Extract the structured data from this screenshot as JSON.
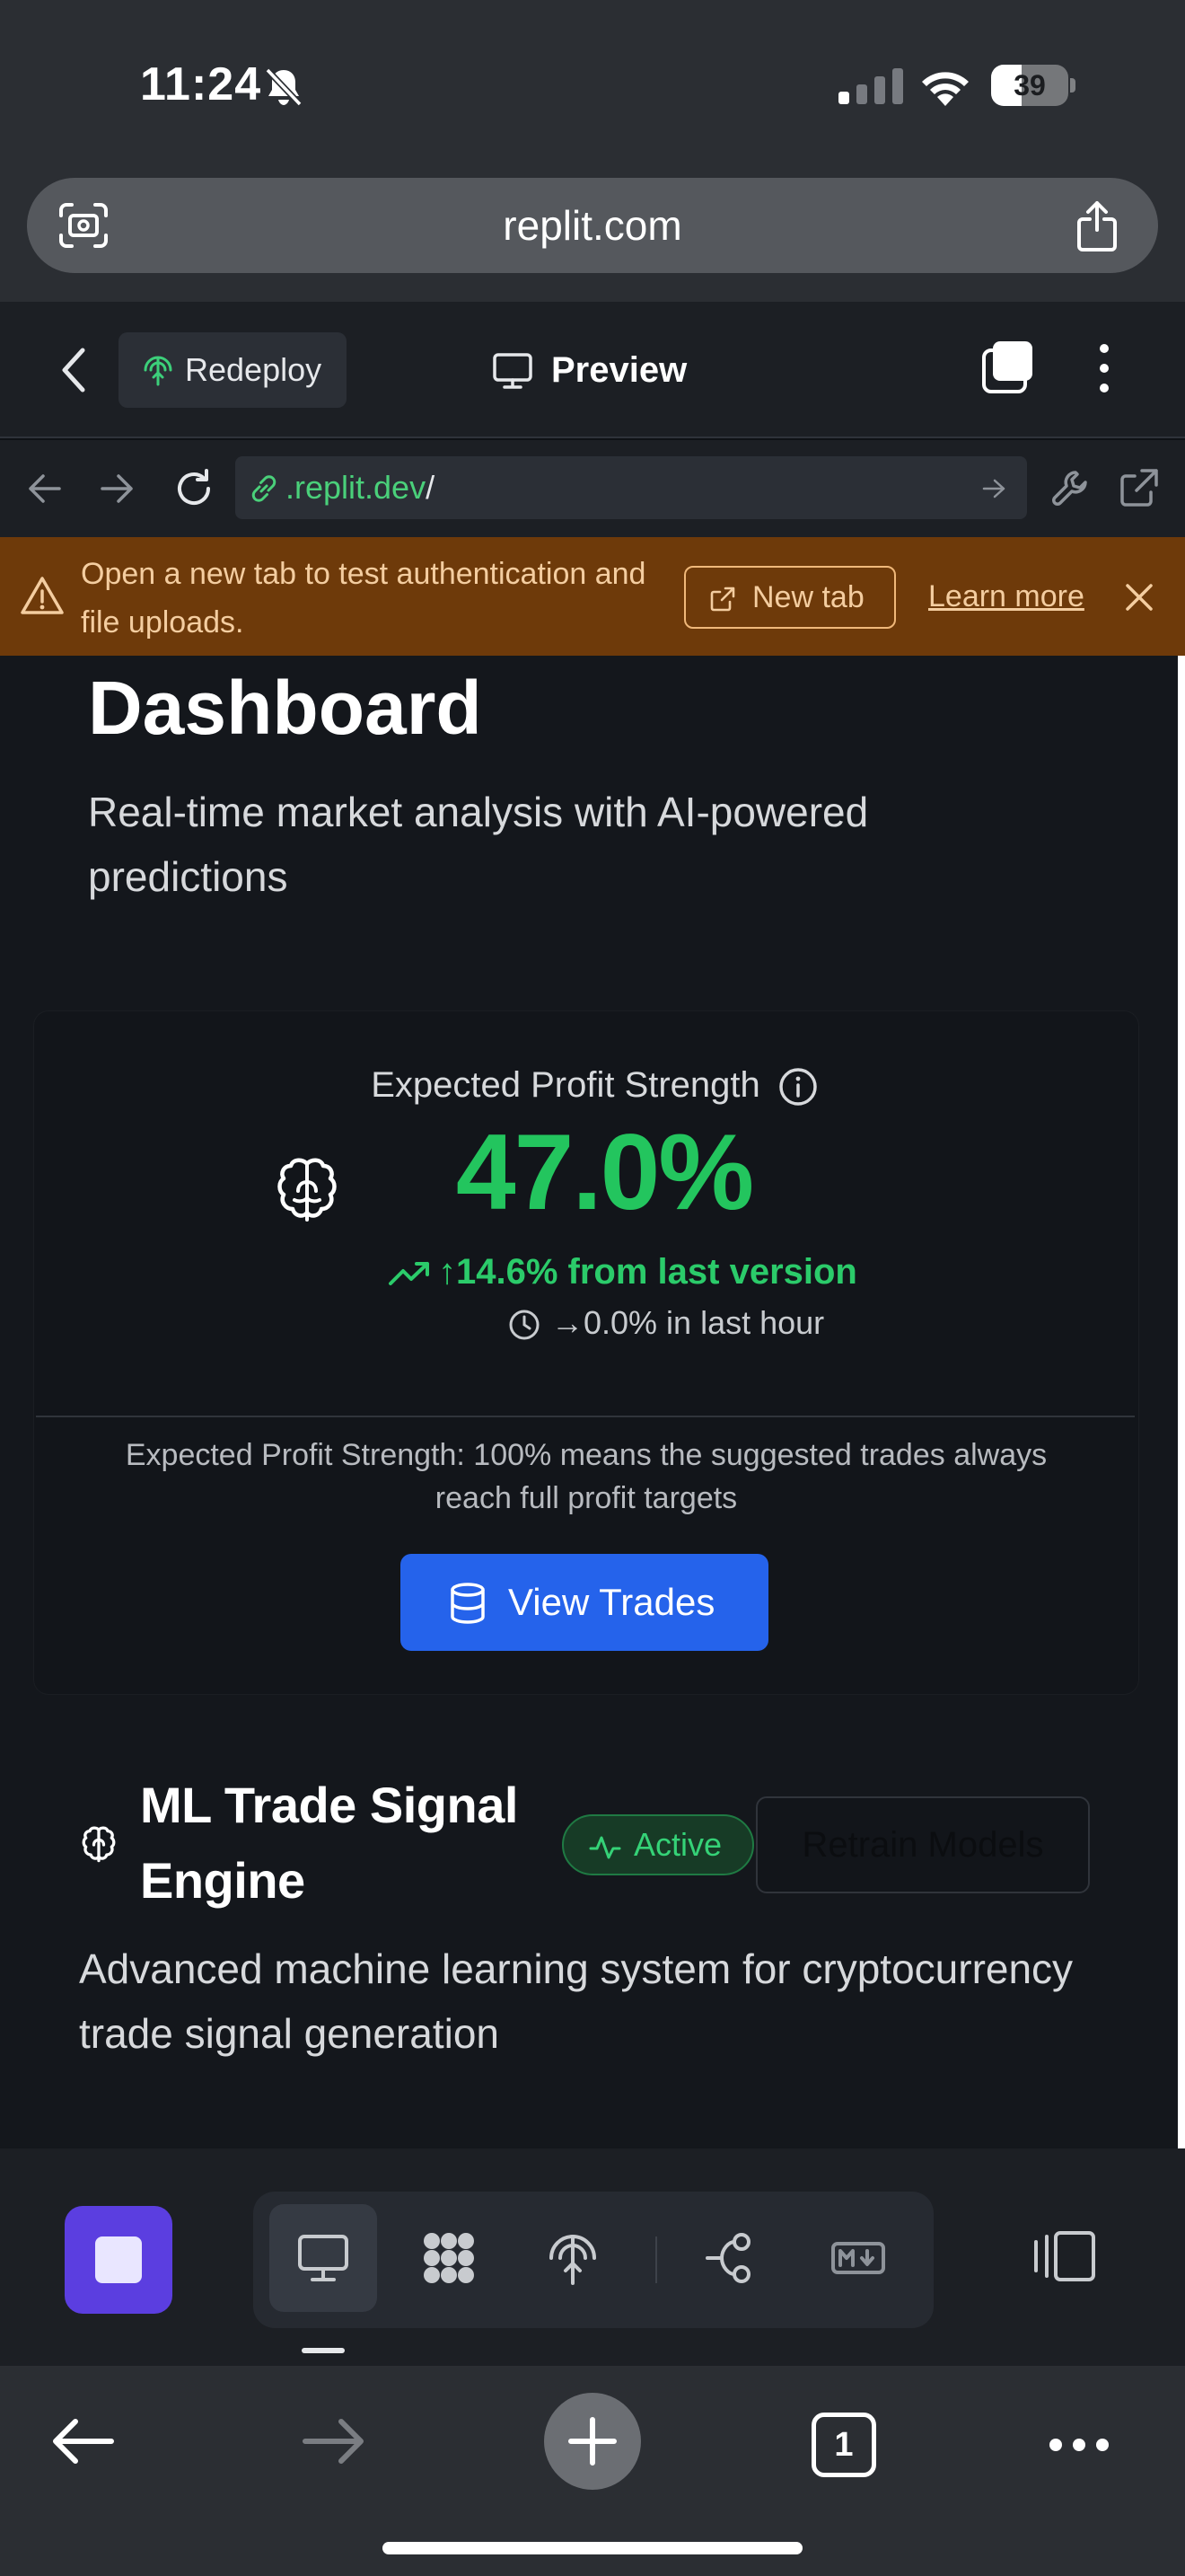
{
  "status": {
    "time": "11:24",
    "battery": "39"
  },
  "browser": {
    "domain": "replit.com",
    "tab_count": "1"
  },
  "replit": {
    "redeploy_label": "Redeploy",
    "preview_label": "Preview",
    "address_host": ".replit.dev",
    "address_path": "/"
  },
  "banner": {
    "message": "Open a new tab to test authentication and file uploads.",
    "new_tab_label": "New tab",
    "learn_more_label": "Learn more"
  },
  "page": {
    "title": "Dashboard",
    "subtitle": "Real-time market analysis with AI-powered predictions"
  },
  "metric": {
    "label": "Expected Profit Strength",
    "value": "47.0%",
    "change": "↑14.6% from last version",
    "hourly": "→0.0% in last hour",
    "explanation": "Expected Profit Strength: 100% means the suggested trades always reach full profit targets",
    "button_label": "View Trades"
  },
  "engine": {
    "title": "ML Trade Signal Engine",
    "status": "Active",
    "retrain_label": "Retrain Models",
    "description": "Advanced machine learning system for cryptocurrency trade signal generation"
  },
  "icons": {
    "status_bar": [
      "bell-slash-icon",
      "cellular-signal-icon",
      "wifi-icon",
      "battery-icon"
    ],
    "browser": [
      "page-screenshot-icon",
      "share-icon"
    ],
    "dock": [
      "stop-icon",
      "monitor-icon",
      "apps-grid-icon",
      "deploy-icon",
      "git-icon",
      "markdown-icon",
      "layout-toggle-icon"
    ],
    "safari": [
      "back-icon",
      "forward-icon",
      "new-tab-icon",
      "tabs-icon",
      "more-icon"
    ]
  },
  "colors": {
    "accent_green": "#23c55e",
    "primary_button": "#2563eb",
    "warning_banner": "#6e3a0a",
    "stop_button": "#5b3ee0"
  }
}
